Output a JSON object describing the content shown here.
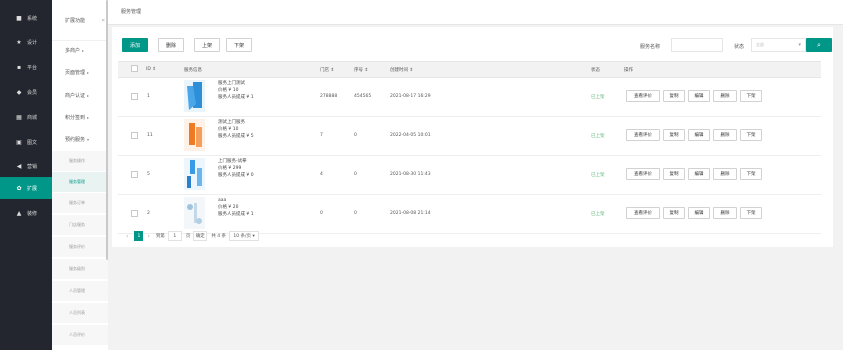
{
  "nav": {
    "items": [
      {
        "icon": "■",
        "label": "系统"
      },
      {
        "icon": "★",
        "label": "设计"
      },
      {
        "icon": "▪",
        "label": "平台"
      },
      {
        "icon": "◆",
        "label": "会员"
      },
      {
        "icon": "▦",
        "label": "商城"
      },
      {
        "icon": "▣",
        "label": "图文"
      },
      {
        "icon": "◀",
        "label": "营销"
      },
      {
        "icon": "✿",
        "label": "扩展"
      },
      {
        "icon": "▲",
        "label": "装修"
      }
    ]
  },
  "submenu": {
    "title": "扩展功能",
    "collapse_icon": "«",
    "groups": [
      {
        "label": "多商户",
        "arrow": "▸"
      },
      {
        "label": "页面管理",
        "arrow": "▸"
      },
      {
        "label": "商户认证",
        "arrow": "▸"
      },
      {
        "label": "积分签到",
        "arrow": "▸"
      },
      {
        "label": "预约服务",
        "arrow": "▾"
      }
    ],
    "children": [
      "服务操作",
      "服务管理",
      "服务订单",
      "门店服务",
      "服务评价",
      "服务级别",
      "人员管理",
      "人员列表",
      "人员评价"
    ]
  },
  "breadcrumb": "服务管理",
  "toolbar": {
    "add": "添加",
    "delete": "删除",
    "up": "上架",
    "down": "下架"
  },
  "filters": {
    "service_name_label": "服务名称",
    "service_name_value": "",
    "status_label": "状态",
    "status_value": "全部",
    "search_icon": "⌕"
  },
  "table": {
    "headers": {
      "id": "ID ⇕",
      "info": "服务信息",
      "sales": "门店 ⇕",
      "sort": "序号 ⇕",
      "created": "创建时间 ⇕",
      "status": "状态",
      "actions": "操作"
    },
    "rows": [
      {
        "id": "1",
        "line1": "服务上门测试",
        "line2": "价格 ¥ 10",
        "line3": "服务人员提成 ¥ 1",
        "sales": "278888",
        "sort": "454565",
        "created": "2021-08-17 16:29",
        "status": "已上架"
      },
      {
        "id": "11",
        "line1": "测试上门服务",
        "line2": "价格 ¥ 10",
        "line3": "服务人员提成 ¥ 5",
        "sales": "7",
        "sort": "0",
        "created": "2022-04-05 10:01",
        "status": "已上架"
      },
      {
        "id": "5",
        "line1": "上门服务-试拳",
        "line2": "价格 ¥ 299",
        "line3": "服务人员提成 ¥ 0",
        "sales": "4",
        "sort": "0",
        "created": "2021-08-30 11:43",
        "status": "已上架"
      },
      {
        "id": "2",
        "line1": "aaa",
        "line2": "价格 ¥ 20",
        "line3": "服务人员提成 ¥ 1",
        "sales": "0",
        "sort": "0",
        "created": "2021-08-08 21:14",
        "status": "已上架"
      }
    ],
    "action_labels": [
      "查看评价",
      "复制",
      "编辑",
      "删除",
      "下架"
    ]
  },
  "pager": {
    "prev": "‹",
    "page": "1",
    "next": "›",
    "goto_label": "到第",
    "goto_value": "1",
    "page_unit": "页",
    "confirm": "确定",
    "total": "共 4 条",
    "per_page": "10 条/页 ▾"
  },
  "colors": {
    "accent": "#009688",
    "nav_bg": "#23262e",
    "status_green": "#5fb878"
  }
}
